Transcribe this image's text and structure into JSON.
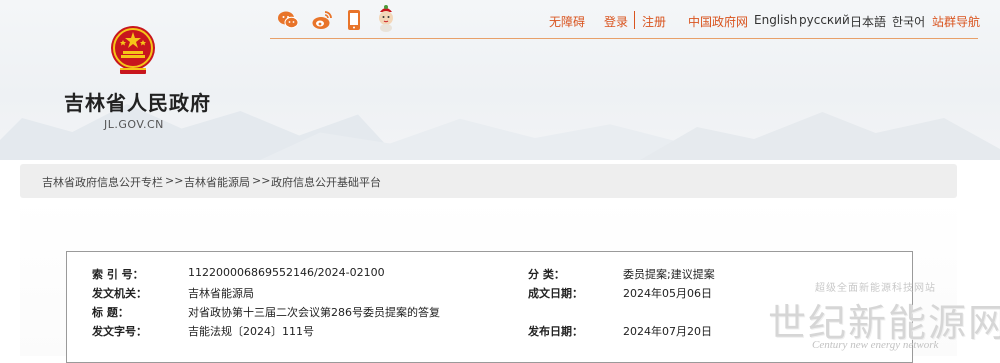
{
  "site": {
    "name": "吉林省人民政府",
    "domain": "JL.GOV.CN"
  },
  "topbar": {
    "icons": [
      "wechat-icon",
      "weibo-icon",
      "mobile-icon",
      "mascot-icon"
    ],
    "accessibility": "无障碍",
    "login": "登录",
    "register": "注册",
    "china_gov": "中国政府网",
    "lang_en": "English",
    "lang_ru": "русский",
    "lang_ja": "日本語",
    "lang_ko": "한국어",
    "sitemap": "站群导航"
  },
  "breadcrumb": {
    "item1": "吉林省政府信息公开专栏",
    "sep": ">>",
    "item2": "吉林省能源局",
    "item3": "政府信息公开基础平台"
  },
  "doc": {
    "index_label": "索 引 号：",
    "index_value": "112200006869552146/2024-02100",
    "category_label": "分    类：",
    "category_value": "委员提案;建议提案",
    "issuer_label": "发文机关：",
    "issuer_value": "吉林省能源局",
    "date_written_label": "成文日期：",
    "date_written_value": "2024年05月06日",
    "title_label": "标      题：",
    "title_value": "对省政协第十三届二次会议第286号委员提案的答复",
    "doc_no_label": "发文字号：",
    "doc_no_value": "吉能法规〔2024〕111号",
    "publish_date_label": "发布日期：",
    "publish_date_value": "2024年07月20日"
  },
  "watermark": {
    "top": "超级全面新能源科技网站",
    "main": "世纪新能源网",
    "sub": "Century new energy network"
  },
  "colors": {
    "accent": "#d9541f",
    "emblem_red": "#c8161d",
    "emblem_gold": "#f5c518"
  }
}
